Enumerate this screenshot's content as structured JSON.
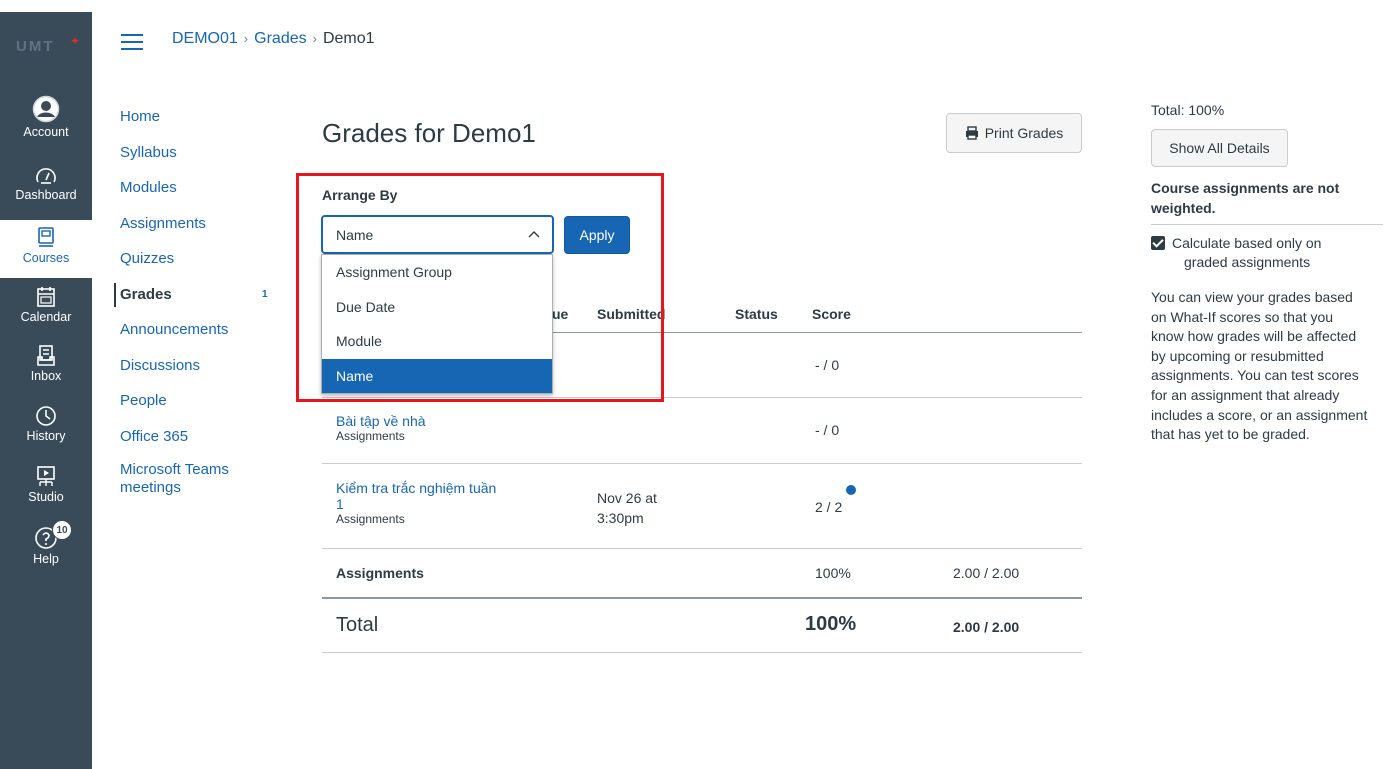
{
  "global_nav": {
    "logo": "UMT",
    "items": [
      {
        "label": "Account",
        "icon": "account-icon"
      },
      {
        "label": "Dashboard",
        "icon": "dashboard-icon"
      },
      {
        "label": "Courses",
        "icon": "courses-icon"
      },
      {
        "label": "Calendar",
        "icon": "calendar-icon"
      },
      {
        "label": "Inbox",
        "icon": "inbox-icon"
      },
      {
        "label": "History",
        "icon": "history-icon"
      },
      {
        "label": "Studio",
        "icon": "studio-icon"
      },
      {
        "label": "Help",
        "icon": "help-icon"
      }
    ],
    "help_badge": "10",
    "colors": {
      "bg": "#394b58",
      "active_text": "#1766b3"
    }
  },
  "breadcrumb": {
    "course": "DEMO01",
    "section": "Grades",
    "current": "Demo1",
    "separator": "›"
  },
  "course_nav": {
    "items": [
      "Home",
      "Syllabus",
      "Modules",
      "Assignments",
      "Quizzes",
      "Grades",
      "Announcements",
      "Discussions",
      "People",
      "Office 365",
      "Microsoft Teams meetings"
    ],
    "grades_count": "1"
  },
  "main": {
    "title": "Grades for Demo1",
    "print_label": "Print Grades",
    "arrange_label": "Arrange By",
    "select_value": "Name",
    "apply_label": "Apply",
    "dropdown_options": [
      "Assignment Group",
      "Due Date",
      "Module",
      "Name"
    ],
    "table": {
      "headers": {
        "due_fragment": "ue",
        "submitted": "Submitted",
        "status": "Status",
        "score": "Score"
      },
      "rows": [
        {
          "score": "- / 0"
        },
        {
          "name": "Bài tập về nhà",
          "group": "Assignments",
          "score": "- / 0"
        },
        {
          "name_line1": "Kiểm tra trắc nghiệm tuần",
          "name_line2": "1",
          "group": "Assignments",
          "submitted_line1": "Nov 26 at",
          "submitted_line2": "3:30pm",
          "score": "2 / 2"
        }
      ],
      "group_row": {
        "name": "Assignments",
        "percent": "100%",
        "points": "2.00 / 2.00"
      },
      "total_row": {
        "name": "Total",
        "percent": "100%",
        "points": "2.00 / 2.00"
      }
    }
  },
  "sidebar": {
    "total": "Total: 100%",
    "show_all": "Show All Details",
    "weighted_line1": "Course assignments are not",
    "weighted_line2": "weighted.",
    "checkbox_line1": "Calculate based only on",
    "checkbox_line2": "graded assignments",
    "whatif_lines": [
      "You can view your grades based",
      "on What-If scores so that you",
      "know how grades will be affected",
      "by upcoming or resubmitted",
      "assignments. You can test scores",
      "for an assignment that already",
      "includes a score, or an assignment",
      "that has yet to be graded."
    ]
  }
}
